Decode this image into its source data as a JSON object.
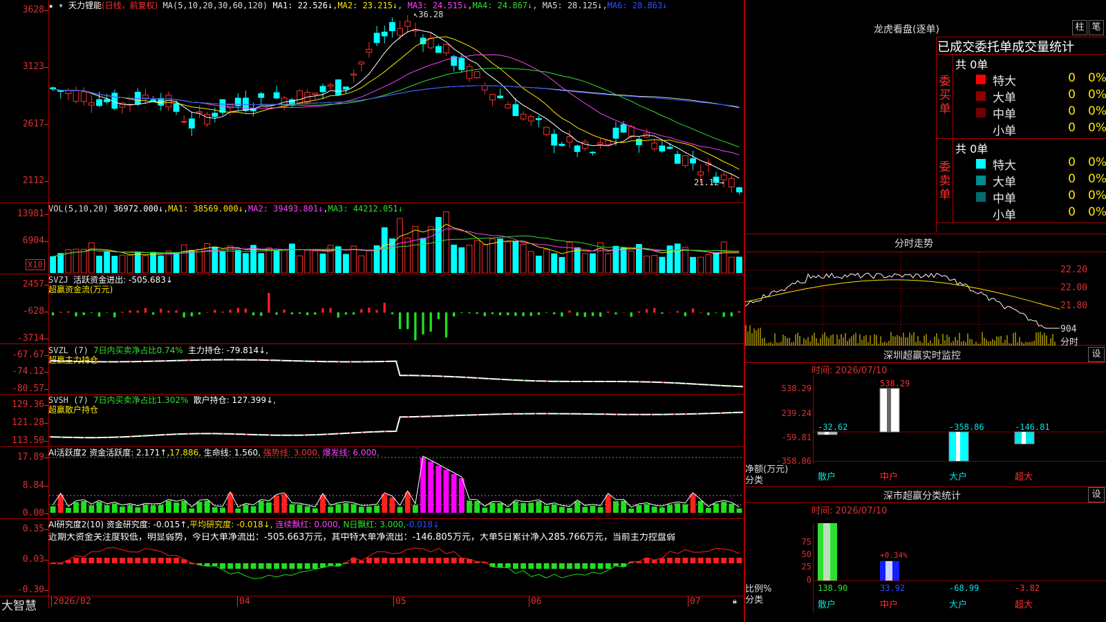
{
  "app": {
    "brand": "大智慧"
  },
  "stock": {
    "name": "天力锂能",
    "period": "(日线，前复权)"
  },
  "main_chart": {
    "ma_params": "MA(5,10,20,30,60,120)",
    "ma": [
      {
        "label": "MA1: 22.526↓",
        "color": "#ffffff"
      },
      {
        "label": "MA2: 23.215↓",
        "color": "#ffe600"
      },
      {
        "label": "MA3: 24.515↓",
        "color": "#ff40ff"
      },
      {
        "label": "MA4: 24.867↓",
        "color": "#30e030"
      },
      {
        "label": "MA5: 28.125↓",
        "color": "#dddddd"
      },
      {
        "label": "MA6: 28.863↓",
        "color": "#3050ff"
      }
    ],
    "y_ticks": [
      "3628",
      "3123",
      "2617",
      "2112"
    ],
    "high_label": "36.28",
    "low_label": "21.12"
  },
  "vol_panel": {
    "title": "VOL(5,10,20)",
    "value": "36972.000↓",
    "ma": [
      {
        "label": "MA1: 38569.000↓",
        "color": "#ffe600"
      },
      {
        "label": "MA2: 39493.801↓",
        "color": "#ff40ff"
      },
      {
        "label": "MA3: 44212.051↓",
        "color": "#30e030"
      }
    ],
    "y_ticks": [
      "13981",
      "6904"
    ],
    "unit": "X10"
  },
  "svzj_panel": {
    "title": "SVZJ",
    "desc": "活跃资金进出: -505.683↓",
    "sub": "超赢资金流(万元)",
    "y_ticks": [
      "2457",
      "-628",
      "-3714"
    ]
  },
  "svzl_panel": {
    "title": "SVZL (7)",
    "ratio": "7日内买卖净占比0.74%",
    "desc": "主力持仓: -79.814↓,",
    "sub": "超赢主力持仓",
    "y_ticks": [
      "-67.67",
      "-74.12",
      "-80.57"
    ]
  },
  "svsh_panel": {
    "title": "SVSH (7)",
    "ratio": "7日内买卖净占比1.302%",
    "desc": "散户持仓: 127.399↓,",
    "sub": "超赢散户持仓",
    "y_ticks": [
      "129.36",
      "121.28",
      "113.50"
    ]
  },
  "ai_active": {
    "title": "AI活跃度2 资金活跃度: 2.171↑,",
    "v1": "17.886,",
    "v2": "生命线: 1.560,",
    "v3": "强势线: 3.000,",
    "v4": "爆发线: 6.000,",
    "y_ticks": [
      "17.89",
      "8.84",
      "0.00"
    ]
  },
  "ai_research": {
    "title": "AI研究度2(10) 资金研究度: -0.015↑,",
    "v1": "平均研究度: -0.018↓,",
    "v2": "连续飘红: 0.000,",
    "v3": "N日飘红: 3.000,",
    "v4": "-0.018↓",
    "comment": "近期大资金关注度较低，明显弱势，今日大单净流出：-505.663万元，其中特大单净流出：-146.805万元，大单5日累计净入285.766万元，当前主力控盘弱",
    "y_ticks": [
      "0.35",
      "0.03",
      "-0.30"
    ]
  },
  "x_axis": [
    "2026/02",
    "04",
    "05",
    "06",
    "07"
  ],
  "dragon_tiger": {
    "title": "龙虎看盘(逐单)",
    "btn1": "柱",
    "btn2": "笔",
    "table_header": "已成交委托单成交量统计",
    "buy": {
      "label": "委买单",
      "total": "共 0单",
      "rows": [
        {
          "name": "特大",
          "value": "0",
          "pct": "0%",
          "color": "#ff0000"
        },
        {
          "name": "大单",
          "value": "0",
          "pct": "0%",
          "color": "#900000"
        },
        {
          "name": "中单",
          "value": "0",
          "pct": "0%",
          "color": "#700000"
        },
        {
          "name": "小单",
          "value": "0",
          "pct": "0%",
          "color": "#000000"
        }
      ]
    },
    "sell": {
      "label": "委卖单",
      "total": "共 0单",
      "rows": [
        {
          "name": "特大",
          "value": "0",
          "pct": "0%",
          "color": "#00ffff"
        },
        {
          "name": "大单",
          "value": "0",
          "pct": "0%",
          "color": "#008c8c"
        },
        {
          "name": "中单",
          "value": "0",
          "pct": "0%",
          "color": "#006e6e"
        },
        {
          "name": "小单",
          "value": "0",
          "pct": "0%",
          "color": "#000000"
        }
      ]
    }
  },
  "intraday": {
    "title": "分时走势",
    "y_ticks": [
      "22.20",
      "22.00",
      "21.80"
    ],
    "vol_label": "904",
    "vol_unit": "分时"
  },
  "sz_monitor": {
    "title": "深圳超赢实时监控",
    "btn": "设",
    "time": "时间: 2026/07/10",
    "y_ticks": [
      "538.29",
      "239.24",
      "-59.81",
      "-358.86"
    ],
    "y_label": "净额(万元)",
    "x_label": "分类",
    "categories": [
      "散户",
      "中户",
      "大户",
      "超大"
    ],
    "values": [
      "-32.62",
      "538.29",
      "-358.86",
      "-146.81"
    ]
  },
  "sz_class": {
    "title": "深市超赢分类统计",
    "btn": "设",
    "time": "时间: 2026/07/10",
    "y_ticks": [
      "75",
      "50",
      "25",
      "0"
    ],
    "y_label": "比例%",
    "x_label": "分类",
    "categories": [
      "散户",
      "中户",
      "大户",
      "超大"
    ],
    "values": [
      "138.90",
      "33.92",
      "-68.99",
      "-3.82"
    ],
    "bar_note": "+0.34%"
  }
}
